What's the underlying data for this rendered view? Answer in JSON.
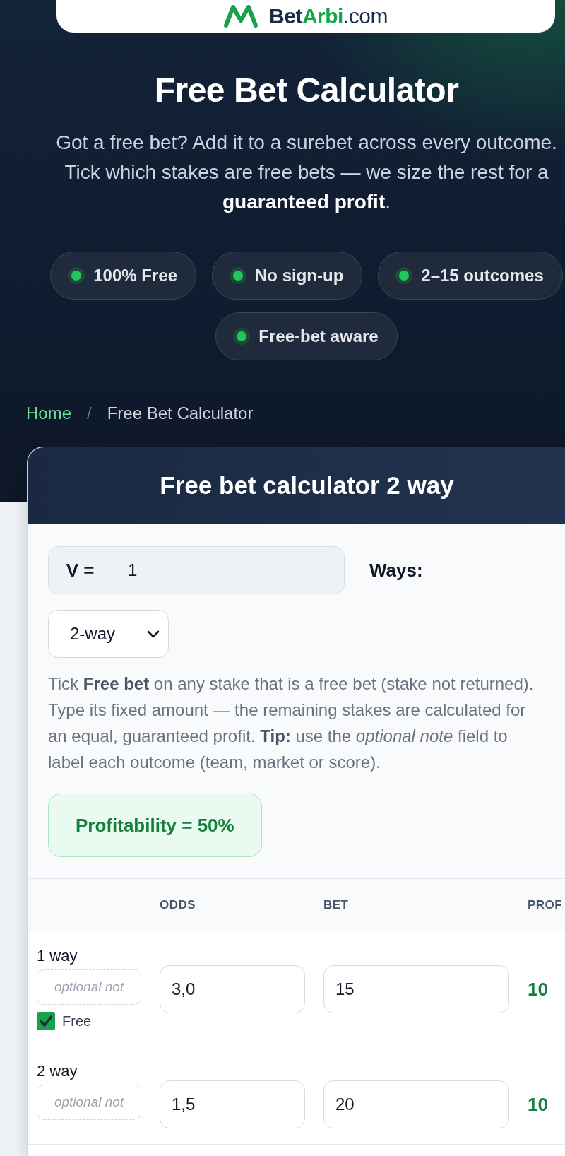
{
  "logo": {
    "parts": [
      {
        "text": "Bet",
        "kind": "brand"
      },
      {
        "text": "Arbi",
        "kind": "accent"
      },
      {
        "text": ".com",
        "kind": "domain"
      }
    ]
  },
  "hero": {
    "title": "Free Bet Calculator",
    "intro": "Got a free bet? Add it to a surebet across every outcome. Tick which stakes are free bets — we size the rest for a **guaranteed profit**.",
    "features": [
      "100% Free",
      "No sign-up",
      "2–15 outcomes",
      "Free-bet aware"
    ]
  },
  "breadcrumb": {
    "separator": "/",
    "items": [
      {
        "label": "Home",
        "kind": "link"
      },
      {
        "label": "Free Bet Calculator",
        "kind": "current"
      }
    ]
  },
  "calculator": {
    "title": "Free bet calculator 2 way",
    "stake": {
      "label": "V =",
      "value": "1"
    },
    "ways": {
      "label": "Ways:",
      "value": "2-way"
    },
    "help": "Tick **Free bet** on any stake that is a free bet (stake not returned). Type its fixed amount — the remaining stakes are calculated for an equal, guaranteed profit. **Tip:** use the *optional note* field to label each outcome (team, market or score).",
    "profitability": "Profitability = 50%",
    "table": {
      "columns": [
        "ODDS",
        "BET",
        "PROF"
      ],
      "rows": [
        {
          "label": "1 way",
          "note": {
            "placeholder": "optional not"
          },
          "free": true,
          "free_label": "Free",
          "odds": "3,0",
          "bet": "15",
          "profit": "10"
        },
        {
          "label": "2 way",
          "note": {
            "placeholder": "optional not"
          },
          "odds": "1,5",
          "bet": "20",
          "profit": "10"
        }
      ]
    }
  }
}
